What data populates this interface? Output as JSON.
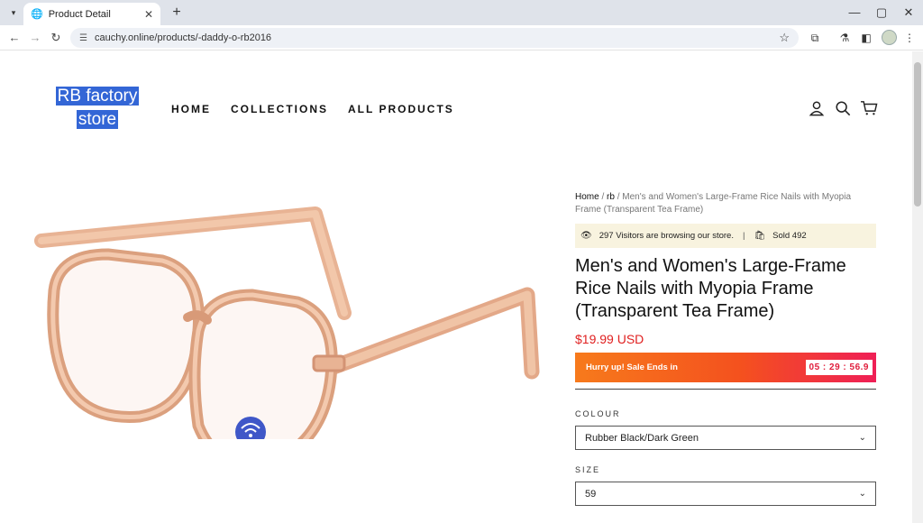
{
  "browser": {
    "tab_title": "Product Detail",
    "url": "cauchy.online/products/-daddy-o-rb2016"
  },
  "store": {
    "logo_line1": "RB factory",
    "logo_line2": "store",
    "nav": [
      "HOME",
      "COLLECTIONS",
      "ALL PRODUCTS"
    ]
  },
  "product": {
    "breadcrumb": {
      "home": "Home",
      "sep1": " / ",
      "collection": "rb",
      "sep2": " / ",
      "current": "Men's and Women's Large-Frame Rice Nails with Myopia Frame (Transparent Tea Frame)"
    },
    "visitors_text": "297 Visitors are browsing our store.",
    "separator": "|",
    "sold_text": "Sold 492",
    "title": "Men's and Women's Large-Frame Rice Nails with Myopia Frame (Transparent Tea Frame)",
    "price": "$19.99 USD",
    "sale_text": "Hurry up! Sale Ends in",
    "countdown": "05 : 29 : 56.9",
    "colour_label": "COLOUR",
    "colour_value": "Rubber Black/Dark Green",
    "size_label": "SIZE",
    "size_value": "59"
  },
  "colors": {
    "accent_red": "#e02020",
    "logo_bg": "#3366d6",
    "visitors_bg": "#f8f3df"
  },
  "icons": {
    "header": [
      "account-icon",
      "search-icon",
      "cart-icon"
    ],
    "browser": [
      "back-icon",
      "forward-icon",
      "reload-icon",
      "site-settings-icon",
      "bookmark-star-icon",
      "extensions-icon",
      "labs-icon",
      "sidebar-icon",
      "profile-avatar"
    ]
  }
}
